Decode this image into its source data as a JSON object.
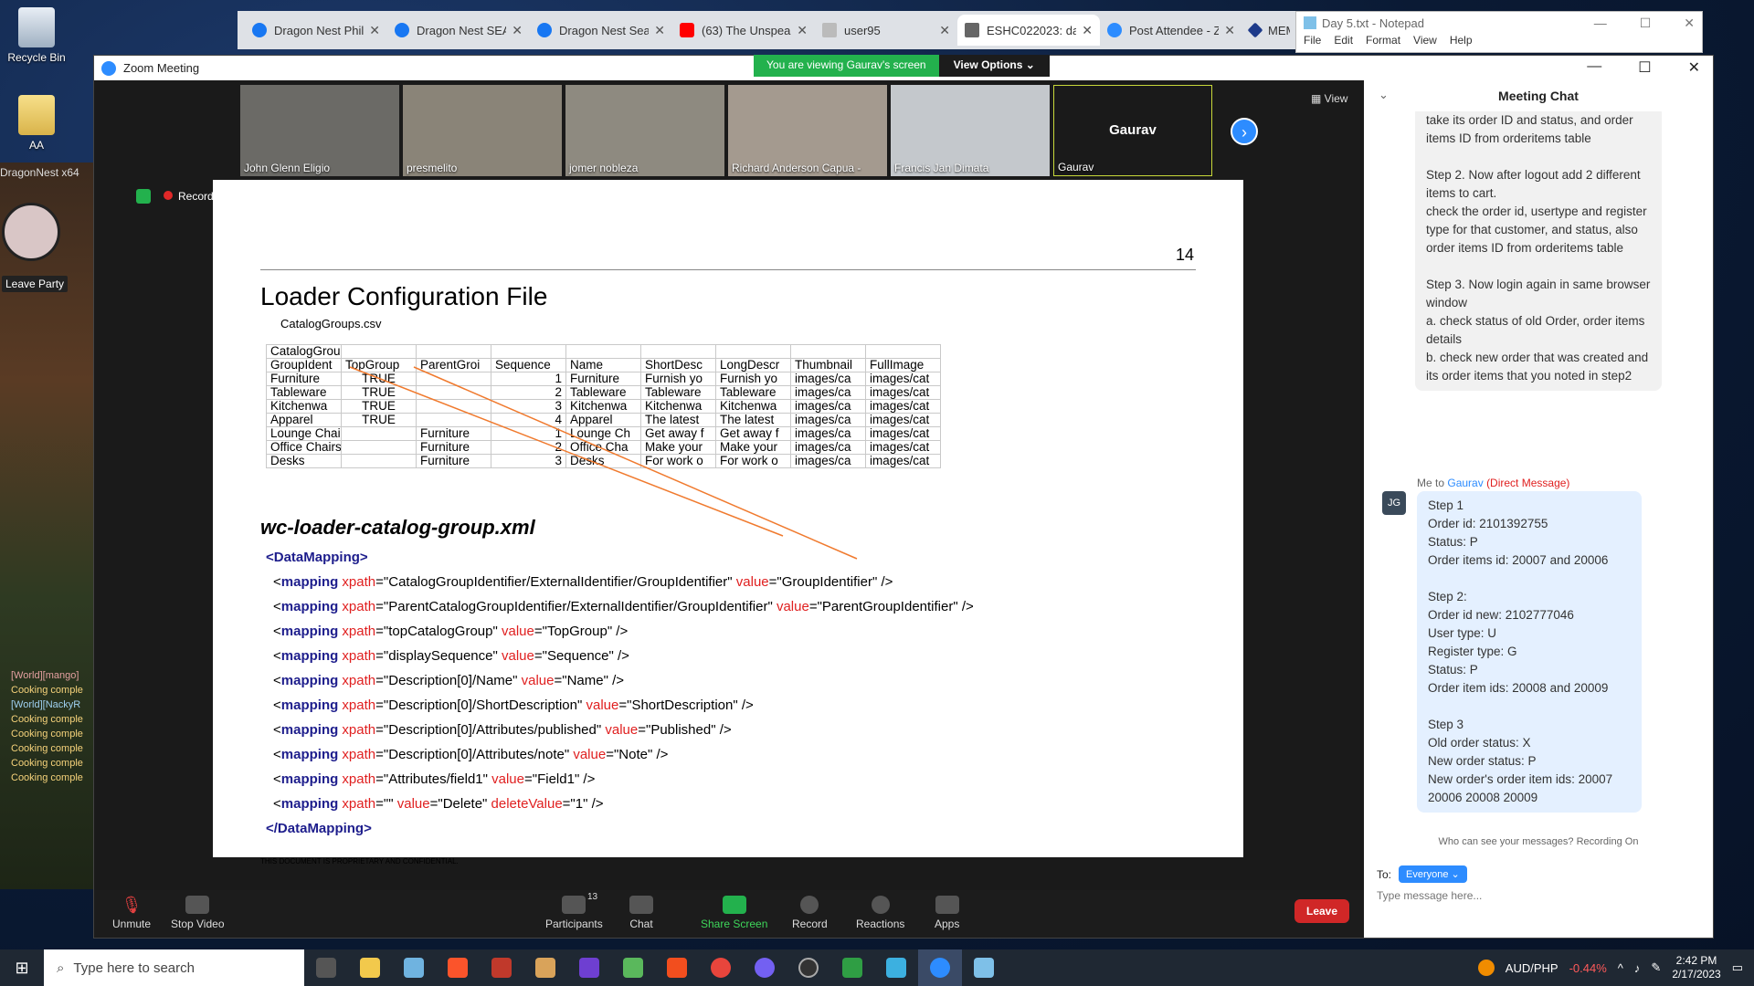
{
  "desktop": {
    "icons": [
      {
        "label": "Recycle Bin"
      },
      {
        "label": "AA"
      }
    ],
    "game": {
      "title": "DragonNest x64",
      "leave_party": "Leave Party",
      "chat_lines": [
        "[World][mango]",
        "Cooking comple",
        "[World][NackyR",
        "Cooking comple",
        "Cooking comple",
        "Cooking comple",
        "Cooking comple",
        "Cooking comple"
      ]
    }
  },
  "browser": {
    "tabs": [
      {
        "label": "Dragon Nest Phil",
        "favicon_color": "#1877f2"
      },
      {
        "label": "Dragon Nest SEA",
        "favicon_color": "#1877f2"
      },
      {
        "label": "Dragon Nest Sea",
        "favicon_color": "#1877f2"
      },
      {
        "label": "(63) The Unspeak",
        "favicon_color": "#ff0000"
      },
      {
        "label": "user95",
        "favicon_color": "#999999"
      },
      {
        "label": "ESHC022023: dat",
        "favicon_color": "#555555"
      },
      {
        "label": "Post Attendee - Z",
        "favicon_color": "#2d8cff"
      },
      {
        "label": "MEM",
        "favicon_color": "#1d3a8a"
      }
    ]
  },
  "notepad": {
    "title": "Day 5.txt - Notepad",
    "menu": [
      "File",
      "Edit",
      "Format",
      "View",
      "Help"
    ]
  },
  "zoom": {
    "window_title": "Zoom Meeting",
    "viewing_banner": "You are viewing Gaurav's screen",
    "view_options": "View Options ⌄",
    "view_label": "View",
    "recording": "Recording",
    "participants": [
      {
        "name": "John Glenn Eligio",
        "color": "#6b6a66"
      },
      {
        "name": "presmelito",
        "color": "#8a8478"
      },
      {
        "name": "jomer nobleza",
        "color": "#8e8a80"
      },
      {
        "name": "Richard Anderson Capua -",
        "color": "#a49a8f"
      },
      {
        "name": "Francis Jan Dimata",
        "color": "#c4c8cc"
      },
      {
        "name": "Gaurav",
        "color": "#1a1a1a"
      }
    ],
    "toolbar": {
      "unmute": "Unmute",
      "stop_video": "Stop Video",
      "participants": "Participants",
      "participants_count": "13",
      "chat": "Chat",
      "share_screen": "Share Screen",
      "record": "Record",
      "reactions": "Reactions",
      "apps": "Apps",
      "leave": "Leave"
    }
  },
  "slide": {
    "page_number": "14",
    "title": "Loader Configuration File",
    "subtitle": "CatalogGroups.csv",
    "csv_rows": [
      [
        "CatalogGroup",
        "",
        "",
        "",
        "",
        "",
        "",
        "",
        ""
      ],
      [
        "GroupIdent",
        "TopGroup",
        "ParentGroi",
        "Sequence",
        "Name",
        "ShortDesc",
        "LongDescr",
        "Thumbnail",
        "FullImage"
      ],
      [
        "Furniture",
        "TRUE",
        "",
        "1",
        "Furniture",
        "Furnish yo",
        "Furnish yo",
        "images/ca",
        "images/cat"
      ],
      [
        "Tableware",
        "TRUE",
        "",
        "2",
        "Tableware",
        "Tableware",
        "Tableware",
        "images/ca",
        "images/cat"
      ],
      [
        "Kitchenwa",
        "TRUE",
        "",
        "3",
        "Kitchenwa",
        "Kitchenwa",
        "Kitchenwa",
        "images/ca",
        "images/cat"
      ],
      [
        "Apparel",
        "TRUE",
        "",
        "4",
        "Apparel",
        "The latest",
        "The latest",
        "images/ca",
        "images/cat"
      ],
      [
        "Lounge Chairs",
        "",
        "Furniture",
        "1",
        "Lounge Ch",
        "Get away f",
        "Get away f",
        "images/ca",
        "images/cat"
      ],
      [
        "Office Chairs",
        "",
        "Furniture",
        "2",
        "Office Cha",
        "Make your",
        "Make your",
        "images/ca",
        "images/cat"
      ],
      [
        "Desks",
        "",
        "Furniture",
        "3",
        "Desks",
        "For work o",
        "For work o",
        "images/ca",
        "images/cat"
      ]
    ],
    "xml_title": "wc-loader-catalog-group.xml",
    "xml_lines": [
      {
        "open": "<DataMapping>"
      },
      {
        "xpath": "CatalogGroupIdentifier/ExternalIdentifier/GroupIdentifier",
        "value": "GroupIdentifier"
      },
      {
        "xpath": "ParentCatalogGroupIdentifier/ExternalIdentifier/GroupIdentifier",
        "value": "ParentGroupIdentifier"
      },
      {
        "xpath": "topCatalogGroup",
        "value": "TopGroup"
      },
      {
        "xpath": "displaySequence",
        "value": "Sequence"
      },
      {
        "xpath": "Description[0]/Name",
        "value": "Name"
      },
      {
        "xpath": "Description[0]/ShortDescription",
        "value": "ShortDescription"
      },
      {
        "xpath": "Description[0]/Attributes/published",
        "value": "Published"
      },
      {
        "xpath": "Description[0]/Attributes/note",
        "value": "Note"
      },
      {
        "xpath": "Attributes/field1",
        "value": "Field1"
      },
      {
        "xpath": "",
        "value": "Delete",
        "deleteValue": "1"
      },
      {
        "close": "</DataMapping>"
      }
    ],
    "confidential": "THIS DOCUMENT IS PROPRIETARY AND CONFIDENTIAL."
  },
  "chat": {
    "header": "Meeting Chat",
    "prev_message": "take its order ID and status, and order items ID from orderitems table\n\nStep 2. Now after logout add 2 different items to cart.\ncheck the order id, usertype and register type for that customer, and status, also order items ID from orderitems table\n\nStep 3.  Now login again in same browser window\na. check status of old Order, order items details\nb. check new order that was created and its order items that you noted in step2",
    "meta_prefix": "Me to",
    "meta_to": "Gaurav",
    "meta_dm": "(Direct Message)",
    "avatar": "JG",
    "my_message": "Step 1\nOrder id: 2101392755\nStatus: P\nOrder items id: 20007 and 20006\n\nStep 2:\nOrder id new: 2102777046\nUser type: U\nRegister type: G\nStatus: P\nOrder item ids: 20008 and 20009\n\nStep 3\nOld order status: X\nNew order status: P\nNew order's order item ids: 20007 20006 20008 20009",
    "who_can_see": "Who can see your messages? Recording On",
    "to_label": "To:",
    "to_value": "Everyone ⌄",
    "placeholder": "Type message here..."
  },
  "taskbar": {
    "search_placeholder": "Type here to search",
    "currency": "AUD/PHP",
    "change": "-0.44%",
    "time": "2:42 PM",
    "date": "2/17/2023"
  }
}
